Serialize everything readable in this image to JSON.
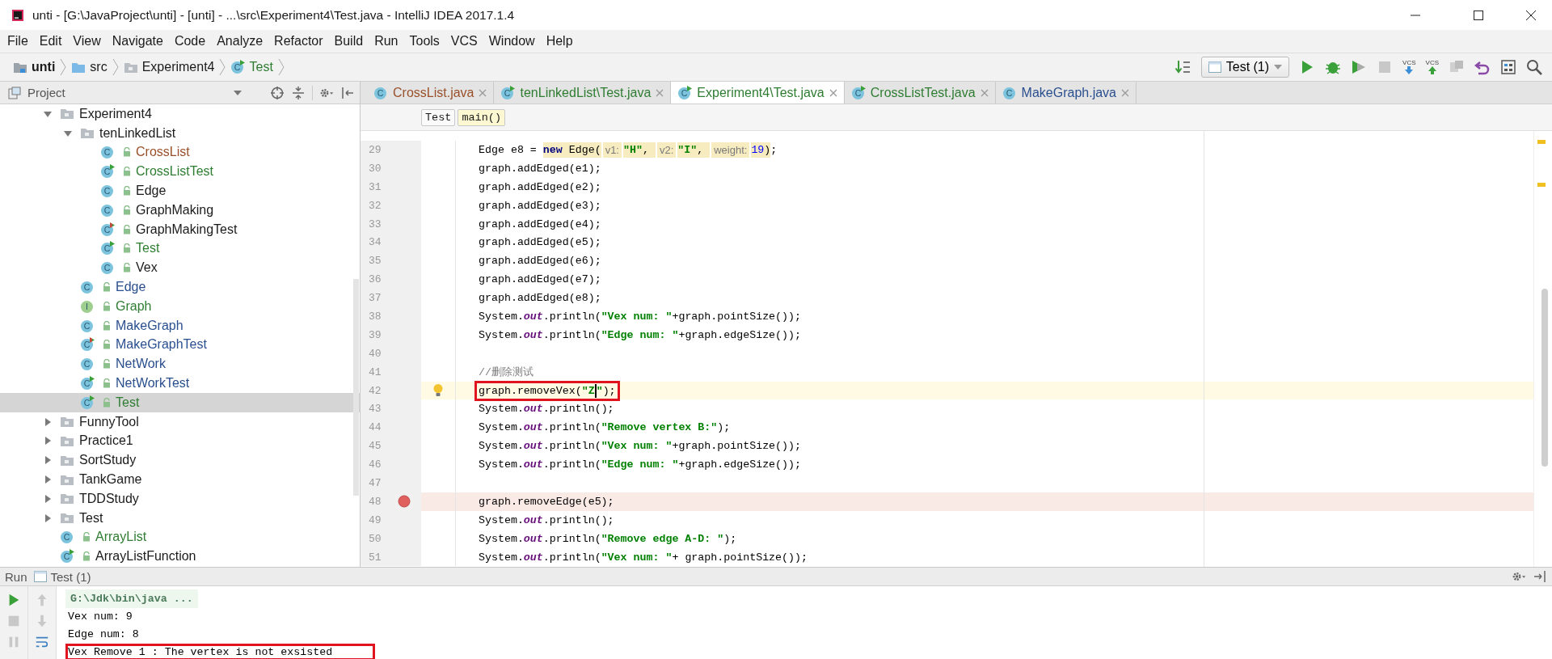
{
  "window": {
    "title": "unti - [G:\\JavaProject\\unti] - [unti] - ...\\src\\Experiment4\\Test.java - IntelliJ IDEA 2017.1.4"
  },
  "menu": [
    "File",
    "Edit",
    "View",
    "Navigate",
    "Code",
    "Analyze",
    "Refactor",
    "Build",
    "Run",
    "Tools",
    "VCS",
    "Window",
    "Help"
  ],
  "breadcrumb": [
    {
      "kind": "module",
      "label": "unti"
    },
    {
      "kind": "folder",
      "label": "src"
    },
    {
      "kind": "package",
      "label": "Experiment4"
    },
    {
      "kind": "class",
      "icon_text": "C",
      "runnable": true,
      "failed": false,
      "label": "Test",
      "color": "#2e7d32"
    }
  ],
  "toolbar": {
    "run_config": "Test (1)",
    "vcs_update": "VCS",
    "vcs_commit": "VCS",
    "stop_disabled": true
  },
  "project": {
    "title": "Project",
    "tree": [
      {
        "kind": "folder",
        "name": "Experiment4",
        "expanded": true,
        "selected": false,
        "children": [
          {
            "kind": "folder",
            "name": "tenLinkedList",
            "expanded": true,
            "selected": false,
            "children": [
              {
                "kind": "class",
                "icon_text": "C",
                "runnable": false,
                "failed": false,
                "name": "CrossList",
                "color": "#99502a",
                "selected": false
              },
              {
                "kind": "class",
                "icon_text": "C",
                "runnable": true,
                "failed": false,
                "name": "CrossListTest",
                "color": "#2e7d32",
                "selected": false
              },
              {
                "kind": "class",
                "icon_text": "C",
                "runnable": false,
                "failed": false,
                "name": "Edge",
                "color": "#1a1a1a",
                "selected": false
              },
              {
                "kind": "class",
                "icon_text": "C",
                "runnable": false,
                "failed": false,
                "name": "GraphMaking",
                "color": "#1a1a1a",
                "selected": false
              },
              {
                "kind": "class",
                "icon_text": "C",
                "runnable": true,
                "failed": true,
                "name": "GraphMakingTest",
                "color": "#1a1a1a",
                "selected": false
              },
              {
                "kind": "class",
                "icon_text": "C",
                "runnable": true,
                "failed": false,
                "name": "Test",
                "color": "#2e7d32",
                "selected": false
              },
              {
                "kind": "class",
                "icon_text": "C",
                "runnable": false,
                "failed": false,
                "name": "Vex",
                "color": "#1a1a1a",
                "selected": false
              }
            ]
          },
          {
            "kind": "class",
            "icon_text": "C",
            "runnable": false,
            "failed": false,
            "name": "Edge",
            "color": "#2a4f8f",
            "selected": false
          },
          {
            "kind": "interface",
            "icon_text": "I",
            "runnable": false,
            "failed": false,
            "name": "Graph",
            "color": "#2e7d32",
            "selected": false
          },
          {
            "kind": "class",
            "icon_text": "C",
            "runnable": false,
            "failed": false,
            "name": "MakeGraph",
            "color": "#2a4f8f",
            "selected": false
          },
          {
            "kind": "class",
            "icon_text": "C",
            "runnable": true,
            "failed": true,
            "name": "MakeGraphTest",
            "color": "#2a4f8f",
            "selected": false
          },
          {
            "kind": "class",
            "icon_text": "C",
            "runnable": false,
            "failed": false,
            "name": "NetWork",
            "color": "#2a4f8f",
            "selected": false
          },
          {
            "kind": "class",
            "icon_text": "C",
            "runnable": true,
            "failed": false,
            "name": "NetWorkTest",
            "color": "#2a4f8f",
            "selected": false
          },
          {
            "kind": "class",
            "icon_text": "C",
            "runnable": true,
            "failed": false,
            "name": "Test",
            "color": "#2e7d32",
            "selected": true
          }
        ]
      },
      {
        "kind": "folder",
        "name": "FunnyTool",
        "expanded": false,
        "selected": false
      },
      {
        "kind": "folder",
        "name": "Practice1",
        "expanded": false,
        "selected": false
      },
      {
        "kind": "folder",
        "name": "SortStudy",
        "expanded": false,
        "selected": false
      },
      {
        "kind": "folder",
        "name": "TankGame",
        "expanded": false,
        "selected": false
      },
      {
        "kind": "folder",
        "name": "TDDStudy",
        "expanded": false,
        "selected": false
      },
      {
        "kind": "folder",
        "name": "Test",
        "expanded": false,
        "selected": false
      },
      {
        "kind": "class",
        "icon_text": "C",
        "runnable": false,
        "failed": false,
        "name": "ArrayList",
        "color": "#2e7d32",
        "selected": false
      },
      {
        "kind": "class",
        "icon_text": "C",
        "runnable": true,
        "failed": false,
        "name": "ArrayListFunction",
        "color": "#1a1a1a",
        "selected": false
      }
    ]
  },
  "editor": {
    "tabs": [
      {
        "label": "CrossList.java",
        "icon_text": "C",
        "runnable": false,
        "color": "#99502a",
        "selected": false
      },
      {
        "label": "tenLinkedList\\Test.java",
        "icon_text": "C",
        "runnable": true,
        "color": "#2e7d32",
        "selected": false
      },
      {
        "label": "Experiment4\\Test.java",
        "icon_text": "C",
        "runnable": true,
        "color": "#2e7d32",
        "selected": true
      },
      {
        "label": "CrossListTest.java",
        "icon_text": "C",
        "runnable": true,
        "color": "#2e7d32",
        "selected": false
      },
      {
        "label": "MakeGraph.java",
        "icon_text": "C",
        "runnable": false,
        "color": "#2a4f8f",
        "selected": false
      }
    ],
    "crumbs": [
      {
        "kind": "class",
        "label": "Test"
      },
      {
        "kind": "method",
        "label": "main()"
      }
    ],
    "lines": [
      {
        "number": "29",
        "boxed": false,
        "tokens": [
          {
            "kind": "plain",
            "text": "Edge e8 = ",
            "marked": false
          },
          {
            "kind": "kw",
            "text": "new",
            "marked": true
          },
          {
            "kind": "plain",
            "text": " Edge(",
            "marked": true
          },
          {
            "kind": "hint",
            "text": "v1:",
            "marked": true
          },
          {
            "kind": "str",
            "text": "\"H\"",
            "marked": true
          },
          {
            "kind": "plain",
            "text": ", ",
            "marked": true
          },
          {
            "kind": "hint",
            "text": "v2:",
            "marked": true
          },
          {
            "kind": "str",
            "text": "\"I\"",
            "marked": true
          },
          {
            "kind": "plain",
            "text": ", ",
            "marked": true
          },
          {
            "kind": "hint",
            "text": "weight:",
            "marked": true
          },
          {
            "kind": "num",
            "text": "19",
            "marked": true
          },
          {
            "kind": "plain",
            "text": ")",
            "marked": true
          },
          {
            "kind": "plain",
            "text": ";",
            "marked": false
          }
        ]
      },
      {
        "number": "30",
        "boxed": false,
        "tokens": [
          {
            "kind": "plain",
            "text": "graph.addEdged(e1);"
          }
        ]
      },
      {
        "number": "31",
        "boxed": false,
        "tokens": [
          {
            "kind": "plain",
            "text": "graph.addEdged(e2);"
          }
        ]
      },
      {
        "number": "32",
        "boxed": false,
        "tokens": [
          {
            "kind": "plain",
            "text": "graph.addEdged(e3);"
          }
        ]
      },
      {
        "number": "33",
        "boxed": false,
        "tokens": [
          {
            "kind": "plain",
            "text": "graph.addEdged(e4);"
          }
        ]
      },
      {
        "number": "34",
        "boxed": false,
        "tokens": [
          {
            "kind": "plain",
            "text": "graph.addEdged(e5);"
          }
        ]
      },
      {
        "number": "35",
        "boxed": false,
        "tokens": [
          {
            "kind": "plain",
            "text": "graph.addEdged(e6);"
          }
        ]
      },
      {
        "number": "36",
        "boxed": false,
        "tokens": [
          {
            "kind": "plain",
            "text": "graph.addEdged(e7);"
          }
        ]
      },
      {
        "number": "37",
        "boxed": false,
        "tokens": [
          {
            "kind": "plain",
            "text": "graph.addEdged(e8);"
          }
        ]
      },
      {
        "number": "38",
        "boxed": false,
        "tokens": [
          {
            "kind": "plain",
            "text": "System."
          },
          {
            "kind": "field",
            "text": "out"
          },
          {
            "kind": "plain",
            "text": ".println("
          },
          {
            "kind": "str",
            "text": "\"Vex num: \""
          },
          {
            "kind": "plain",
            "text": "+graph.pointSize());"
          }
        ]
      },
      {
        "number": "39",
        "boxed": false,
        "tokens": [
          {
            "kind": "plain",
            "text": "System."
          },
          {
            "kind": "field",
            "text": "out"
          },
          {
            "kind": "plain",
            "text": ".println("
          },
          {
            "kind": "str",
            "text": "\"Edge num: \""
          },
          {
            "kind": "plain",
            "text": "+graph.edgeSize());"
          }
        ]
      },
      {
        "number": "40"
      },
      {
        "number": "41",
        "boxed": false,
        "tokens": [
          {
            "kind": "comment",
            "text": "//删除测试"
          }
        ]
      },
      {
        "number": "42",
        "boxed": true,
        "kind": "current",
        "tokens": [
          {
            "kind": "plain",
            "text": "graph.removeVex("
          },
          {
            "kind": "str",
            "text": "\"Z",
            "caret_after": true
          },
          {
            "kind": "str",
            "text": "\""
          },
          {
            "kind": "plain",
            "text": ");"
          }
        ]
      },
      {
        "number": "43",
        "boxed": false,
        "tokens": [
          {
            "kind": "plain",
            "text": "System."
          },
          {
            "kind": "field",
            "text": "out"
          },
          {
            "kind": "plain",
            "text": ".println();"
          }
        ]
      },
      {
        "number": "44",
        "boxed": false,
        "tokens": [
          {
            "kind": "plain",
            "text": "System."
          },
          {
            "kind": "field",
            "text": "out"
          },
          {
            "kind": "plain",
            "text": ".println("
          },
          {
            "kind": "str",
            "text": "\"Remove vertex B:\""
          },
          {
            "kind": "plain",
            "text": ");"
          }
        ]
      },
      {
        "number": "45",
        "boxed": false,
        "tokens": [
          {
            "kind": "plain",
            "text": "System."
          },
          {
            "kind": "field",
            "text": "out"
          },
          {
            "kind": "plain",
            "text": ".println("
          },
          {
            "kind": "str",
            "text": "\"Vex num: \""
          },
          {
            "kind": "plain",
            "text": "+graph.pointSize());"
          }
        ]
      },
      {
        "number": "46",
        "boxed": false,
        "tokens": [
          {
            "kind": "plain",
            "text": "System."
          },
          {
            "kind": "field",
            "text": "out"
          },
          {
            "kind": "plain",
            "text": ".println("
          },
          {
            "kind": "str",
            "text": "\"Edge num: \""
          },
          {
            "kind": "plain",
            "text": "+graph.edgeSize());"
          }
        ]
      },
      {
        "number": "47"
      },
      {
        "number": "48",
        "boxed": false,
        "kind": "breakpoint",
        "tokens": [
          {
            "kind": "plain",
            "text": "graph.removeEdge(e5);"
          }
        ]
      },
      {
        "number": "49",
        "boxed": false,
        "tokens": [
          {
            "kind": "plain",
            "text": "System."
          },
          {
            "kind": "field",
            "text": "out"
          },
          {
            "kind": "plain",
            "text": ".println();"
          }
        ]
      },
      {
        "number": "50",
        "boxed": false,
        "tokens": [
          {
            "kind": "plain",
            "text": "System."
          },
          {
            "kind": "field",
            "text": "out"
          },
          {
            "kind": "plain",
            "text": ".println("
          },
          {
            "kind": "str",
            "text": "\"Remove edge A-D: \""
          },
          {
            "kind": "plain",
            "text": ");"
          }
        ]
      },
      {
        "number": "51",
        "boxed": false,
        "tokens": [
          {
            "kind": "plain",
            "text": "System."
          },
          {
            "kind": "field",
            "text": "out"
          },
          {
            "kind": "plain",
            "text": ".println("
          },
          {
            "kind": "str",
            "text": "\"Vex num: \""
          },
          {
            "kind": "plain",
            "text": "+ graph.pointSize());"
          }
        ]
      }
    ]
  },
  "run": {
    "title": "Run",
    "config": "Test (1)",
    "output": [
      {
        "kind": "command",
        "text": "G:\\Jdk\\bin\\java ...",
        "boxed": false
      },
      {
        "kind": "stdout",
        "text": "Vex num: 9",
        "boxed": false
      },
      {
        "kind": "stdout",
        "text": "Edge num: 8",
        "boxed": false
      },
      {
        "kind": "stdout",
        "text": "Vex Remove 1 : The vertex is not exsisted",
        "boxed": true
      }
    ]
  }
}
